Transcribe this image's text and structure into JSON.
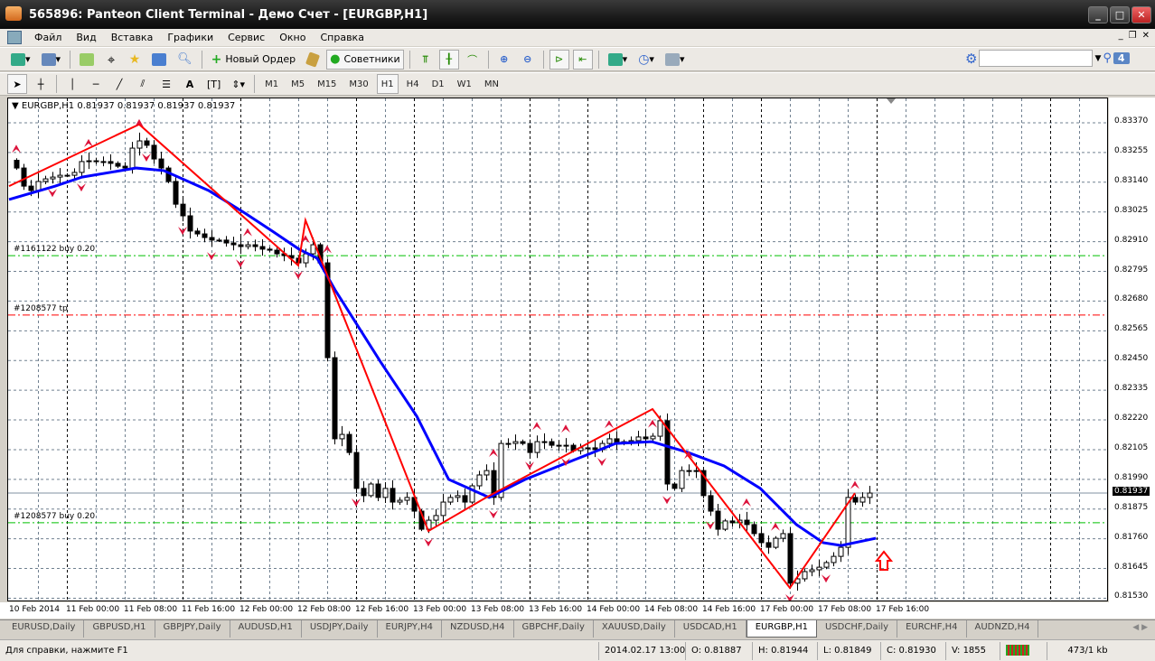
{
  "window": {
    "title": "565896: Panteon Client Terminal - Демо Счет - [EURGBP,H1]"
  },
  "menu": [
    "Файл",
    "Вид",
    "Вставка",
    "Графики",
    "Сервис",
    "Окно",
    "Справка"
  ],
  "toolbar": {
    "new_order": "Новый Ордер",
    "experts": "Советники",
    "search_placeholder": "",
    "notifications": "4"
  },
  "timeframes": [
    "M1",
    "M5",
    "M15",
    "M30",
    "H1",
    "H4",
    "D1",
    "W1",
    "MN"
  ],
  "active_timeframe": "H1",
  "chart": {
    "header": "EURGBP,H1  0.81937 0.81937 0.81937 0.81937",
    "bid": "0.81937",
    "price_labels": [
      "0.83370",
      "0.83255",
      "0.83140",
      "0.83025",
      "0.82910",
      "0.82795",
      "0.82680",
      "0.82565",
      "0.82450",
      "0.82335",
      "0.82220",
      "0.82105",
      "0.81990",
      "0.81875",
      "0.81760",
      "0.81645",
      "0.81530"
    ],
    "time_labels": [
      "10 Feb 2014",
      "11 Feb 00:00",
      "11 Feb 08:00",
      "11 Feb 16:00",
      "12 Feb 00:00",
      "12 Feb 08:00",
      "12 Feb 16:00",
      "13 Feb 00:00",
      "13 Feb 08:00",
      "13 Feb 16:00",
      "14 Feb 00:00",
      "14 Feb 08:00",
      "14 Feb 16:00",
      "17 Feb 00:00",
      "17 Feb 08:00",
      "17 Feb 16:00"
    ],
    "order_lines": [
      {
        "label": "#1161122 buy 0.20",
        "price": 0.82856,
        "color": "#00c000"
      },
      {
        "label": "#1208577 tp",
        "price": 0.82626,
        "color": "#ff0000"
      },
      {
        "label": "#1208577 buy 0.20",
        "price": 0.81822,
        "color": "#00c000"
      }
    ],
    "colors": {
      "zigzag": "#ff0000",
      "ma": "#0000ff",
      "fractal": "#dc143c",
      "grid": "#708090"
    }
  },
  "chart_data": {
    "type": "candlestick",
    "symbol": "EURGBP",
    "timeframe": "H1",
    "ylim": [
      0.8153,
      0.8337
    ],
    "closes": [
      0.83195,
      0.83125,
      0.83108,
      0.83143,
      0.83153,
      0.8316,
      0.83167,
      0.83167,
      0.83178,
      0.8322,
      0.83223,
      0.8322,
      0.8322,
      0.83213,
      0.83202,
      0.83195,
      0.83272,
      0.833,
      0.83283,
      0.8323,
      0.83195,
      0.83143,
      0.83055,
      0.8301,
      0.82951,
      0.8294,
      0.82926,
      0.82916,
      0.82916,
      0.82905,
      0.82898,
      0.82891,
      0.82898,
      0.82891,
      0.82881,
      0.82877,
      0.82863,
      0.82856,
      0.82846,
      0.82828,
      0.82863,
      0.82898,
      0.82828,
      0.82461,
      0.82147,
      0.82164,
      0.82094,
      0.81955,
      0.81927,
      0.81972,
      0.8192,
      0.81955,
      0.81902,
      0.81909,
      0.8192,
      0.81867,
      0.81797,
      0.81832,
      0.8185,
      0.81902,
      0.8192,
      0.81927,
      0.81902,
      0.81965,
      0.82007,
      0.82024,
      0.8192,
      0.82129,
      0.82129,
      0.82136,
      0.82129,
      0.82094,
      0.82136,
      0.82136,
      0.82122,
      0.82119,
      0.82122,
      0.82101,
      0.82112,
      0.82112,
      0.82105,
      0.82129,
      0.82147,
      0.82129,
      0.82136,
      0.8214,
      0.82154,
      0.82147,
      0.82157,
      0.82217,
      0.81972,
      0.81955,
      0.82024,
      0.82024,
      0.82024,
      0.81927,
      0.81867,
      0.81797,
      0.81829,
      0.81822,
      0.81832,
      0.81815,
      0.8178,
      0.81745,
      0.81727,
      0.81762,
      0.8178,
      0.81588,
      0.81605,
      0.81633,
      0.8164,
      0.8165,
      0.81668,
      0.81692,
      0.81727,
      0.8192,
      0.81902,
      0.8192,
      0.81937
    ],
    "zigzag": [
      [
        -1,
        0.83125
      ],
      [
        17,
        0.83364
      ],
      [
        39,
        0.82818
      ],
      [
        40,
        0.82993
      ],
      [
        57,
        0.8179
      ],
      [
        65,
        0.8192
      ],
      [
        88,
        0.82262
      ],
      [
        107,
        0.8157
      ],
      [
        116,
        0.81937
      ]
    ],
    "moving_average": [
      [
        -1,
        0.83073
      ],
      [
        5.4,
        0.83125
      ],
      [
        9.1,
        0.8316
      ],
      [
        16.6,
        0.83195
      ],
      [
        20.4,
        0.83185
      ],
      [
        26.6,
        0.83108
      ],
      [
        31.6,
        0.83021
      ],
      [
        35.4,
        0.82951
      ],
      [
        39.1,
        0.82881
      ],
      [
        41.6,
        0.82846
      ],
      [
        44.1,
        0.82723
      ],
      [
        50.4,
        0.82444
      ],
      [
        55.4,
        0.82234
      ],
      [
        59.8,
        0.8199
      ],
      [
        65.4,
        0.8192
      ],
      [
        70.4,
        0.8199
      ],
      [
        76.6,
        0.82059
      ],
      [
        82.9,
        0.82129
      ],
      [
        87.9,
        0.82136
      ],
      [
        92.9,
        0.82094
      ],
      [
        97.9,
        0.82042
      ],
      [
        102.9,
        0.81955
      ],
      [
        107.9,
        0.81815
      ],
      [
        111.6,
        0.81745
      ],
      [
        114.1,
        0.81734
      ],
      [
        118.9,
        0.81762
      ]
    ],
    "fractals_up": [
      0,
      10,
      17,
      32,
      40,
      43,
      66,
      72,
      76,
      82,
      88,
      93,
      101,
      105,
      116
    ],
    "fractals_down": [
      5,
      9,
      18,
      23,
      27,
      31,
      39,
      47,
      57,
      66,
      71,
      76,
      81,
      90,
      96,
      107,
      112
    ]
  },
  "tabs": [
    "EURUSD,Daily",
    "GBPUSD,H1",
    "GBPJPY,Daily",
    "AUDUSD,H1",
    "USDJPY,Daily",
    "EURJPY,H4",
    "NZDUSD,H4",
    "GBPCHF,Daily",
    "XAUUSD,Daily",
    "USDCAD,H1",
    "EURGBP,H1",
    "USDCHF,Daily",
    "EURCHF,H4",
    "AUDNZD,H4"
  ],
  "active_tab": "EURGBP,H1",
  "status": {
    "help": "Для справки, нажмите F1",
    "datetime": "2014.02.17 13:00",
    "open": "O: 0.81887",
    "high": "H: 0.81944",
    "low": "L: 0.81849",
    "close": "C: 0.81930",
    "volume": "V: 1855",
    "traffic": "473/1 kb"
  }
}
